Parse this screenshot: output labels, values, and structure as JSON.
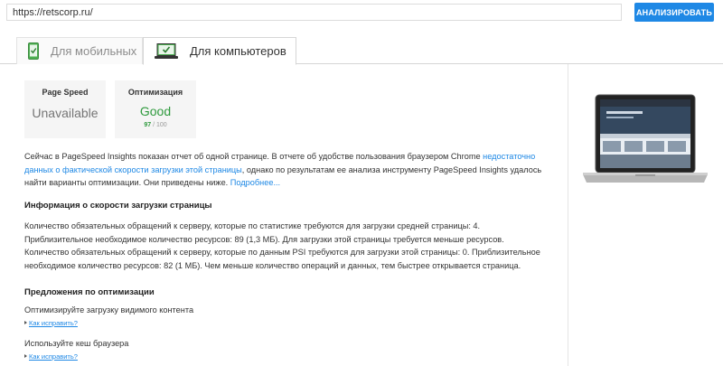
{
  "search": {
    "url_value": "https://retscorp.ru/",
    "analyze_label": "АНАЛИЗИРОВАТЬ"
  },
  "tabs": [
    {
      "label": "Для мобильных",
      "icon": "phone-check-icon",
      "active": false
    },
    {
      "label": "Для компьютеров",
      "icon": "monitor-check-icon",
      "active": true
    }
  ],
  "cards": {
    "page_speed": {
      "label": "Page Speed",
      "value": "Unavailable"
    },
    "optimization": {
      "label": "Оптимизация",
      "value": "Good",
      "score": "97",
      "score_suffix": "/ 100"
    }
  },
  "intro": {
    "text_1": "Сейчас в PageSpeed Insights показан отчет об одной странице. В отчете об удобстве пользования браузером Chrome ",
    "link_1": "недостаточно данных о фактической скорости загрузки этой страницы",
    "text_2": ", однако по результатам ее анализа инструменту PageSpeed Insights удалось найти варианты оптимизации. Они приведены ниже. ",
    "link_2": "Подробнее..."
  },
  "speed": {
    "heading": "Информация о скорости загрузки страницы",
    "line_1": "Количество обязательных обращений к серверу, которые по статистике требуются для загрузки средней страницы: 4.",
    "line_2": "Приблизительное необходимое количество ресурсов: 89 (1,3 МБ). Для загрузки этой страницы требуется меньше ресурсов.",
    "line_3": "Количество обязательных обращений к серверу, которые по данным PSI требуются для загрузки этой страницы: 0. Приблизительное необходимое количество ресурсов: 82 (1 МБ). Чем меньше количество операций и данных, тем быстрее открывается страница."
  },
  "suggestions": {
    "heading": "Предложения по оптимизации",
    "items": [
      {
        "title": "Оптимизируйте загрузку видимого контента",
        "link": "Как исправить?"
      },
      {
        "title": "Используйте кеш браузера",
        "link": "Как исправить?"
      }
    ]
  },
  "colors": {
    "accent": "#1e88e5",
    "good": "#2e9a3d"
  }
}
